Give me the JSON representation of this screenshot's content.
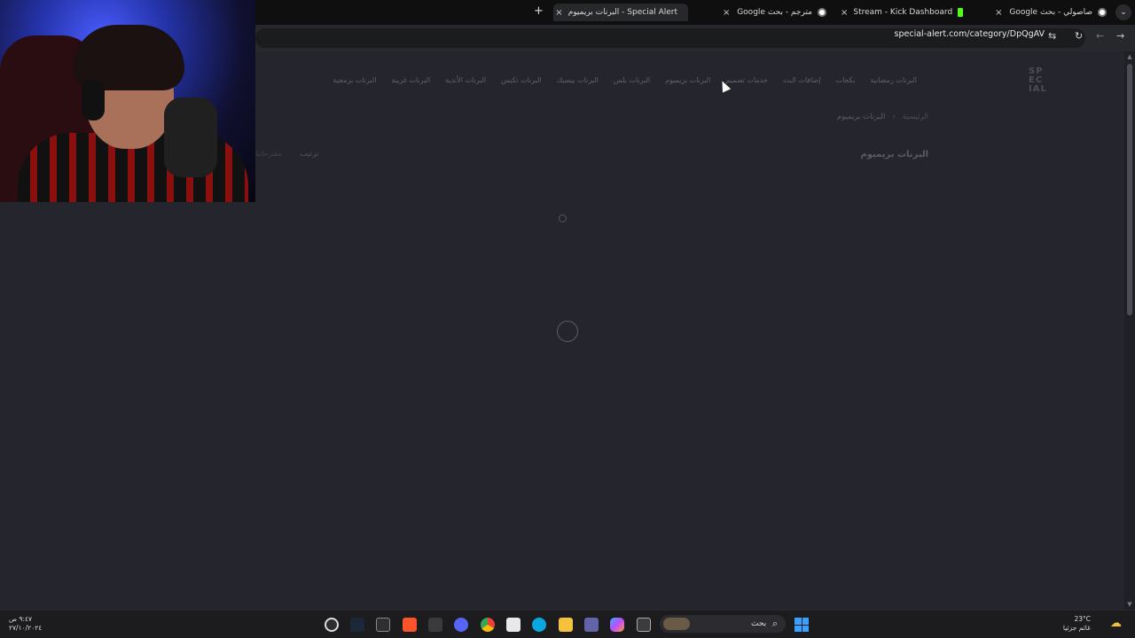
{
  "browser": {
    "tabs": [
      {
        "title": "صاصولي - بحث Google",
        "icon": "google-icon"
      },
      {
        "title": "Stream - Kick Dashboard",
        "icon": "kick-icon"
      },
      {
        "title": "مترجم - بحث Google",
        "icon": "google-icon"
      },
      {
        "title": "Special Alert - البرنات بريميوم",
        "icon": "special-alert-icon",
        "active": true
      }
    ],
    "new_tab_label": "+",
    "close_glyph": "×",
    "tab_menu_glyph": "⌄",
    "url": "special-alert.com/category/DpQgAV"
  },
  "site": {
    "logo_text": "SP EC IAL",
    "nav_items": [
      "البرنات رمضانية",
      "بكجات",
      "إضافات البث",
      "خدمات تصميم",
      "البرنات بريميوم",
      "البرنات بلس",
      "البرنات بيسيك",
      "البرنات تكيس",
      "البرنات الأندية",
      "البرنات غريبة",
      "البرنات برمجية"
    ],
    "breadcrumb": {
      "home": "الرئيسية",
      "separator": "‹",
      "current": "البرنات بريميوم"
    },
    "page_title": "البرنات بريميوم",
    "sort_label": "ترتيب",
    "suggestions_label": "مقترحاتنا"
  },
  "taskbar": {
    "search_placeholder": "بحث",
    "clock_time": "٩:٤٧ ص",
    "clock_date": "٢٧/١٠/٢٠٢٤",
    "weather_temp": "23°C",
    "weather_desc": "غائم جزئيا"
  },
  "colors": {
    "page_bg": "#25262d",
    "tabstrip_bg": "#0f0f10",
    "kick_green": "#53fc18",
    "windows_blue": "#3aa0ff"
  }
}
